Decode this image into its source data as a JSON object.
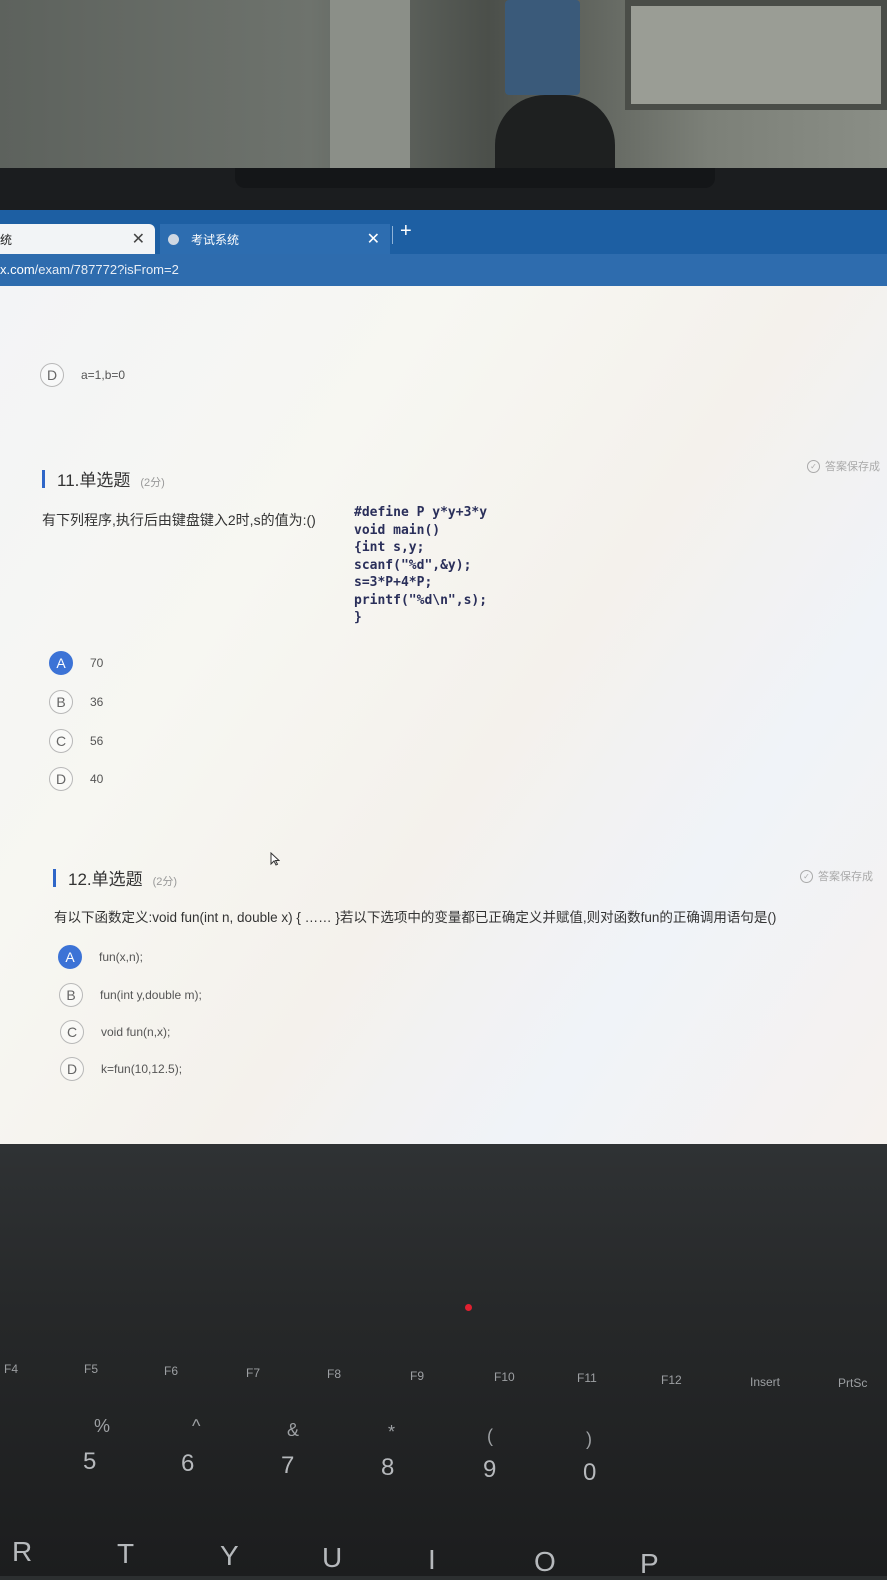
{
  "browser": {
    "active_tab_label": "统",
    "inactive_tab_label": "考试系统",
    "close_glyph": "✕",
    "new_tab_glyph": "+",
    "url_host": "x.com",
    "url_path": "/exam/787772?isFrom=2"
  },
  "prev_option": {
    "letter": "D",
    "text": "a=1,b=0"
  },
  "q11": {
    "number": "11.单选题",
    "score": "(2分)",
    "saved_label": "答案保存成",
    "stem": "有下列程序,执行后由键盘键入2时,s的值为:()",
    "code": [
      "#define P y*y+3*y",
      "void main()",
      "{int s,y;",
      "scanf(\"%d\",&y);",
      "s=3*P+4*P;",
      "printf(\"%d\\n\",s);",
      "}"
    ],
    "options": [
      {
        "letter": "A",
        "text": "70",
        "selected": true
      },
      {
        "letter": "B",
        "text": "36",
        "selected": false
      },
      {
        "letter": "C",
        "text": "56",
        "selected": false
      },
      {
        "letter": "D",
        "text": "40",
        "selected": false
      }
    ]
  },
  "q12": {
    "number": "12.单选题",
    "score": "(2分)",
    "saved_label": "答案保存成",
    "stem": "有以下函数定义:void fun(int n, double x) { …… }若以下选项中的变量都已正确定义并赋值,则对函数fun的正确调用语句是()",
    "options": [
      {
        "letter": "A",
        "text": "fun(x,n);",
        "selected": true
      },
      {
        "letter": "B",
        "text": "fun(int y,double m);",
        "selected": false
      },
      {
        "letter": "C",
        "text": "void fun(n,x);",
        "selected": false
      },
      {
        "letter": "D",
        "text": "k=fun(10,12.5);",
        "selected": false
      }
    ]
  },
  "keyboard": {
    "fn_row": [
      "F4",
      "F5",
      "F6",
      "F7",
      "F8",
      "F9",
      "F10",
      "F11",
      "F12",
      "Insert",
      "PrtSc"
    ],
    "num_row": [
      "5",
      "6",
      "7",
      "8",
      "9",
      "0"
    ],
    "num_shift": [
      "%",
      "^",
      "&",
      "*",
      "(",
      ")"
    ],
    "letter_row": [
      "R",
      "T",
      "Y",
      "U",
      "I",
      "O",
      "P"
    ]
  }
}
